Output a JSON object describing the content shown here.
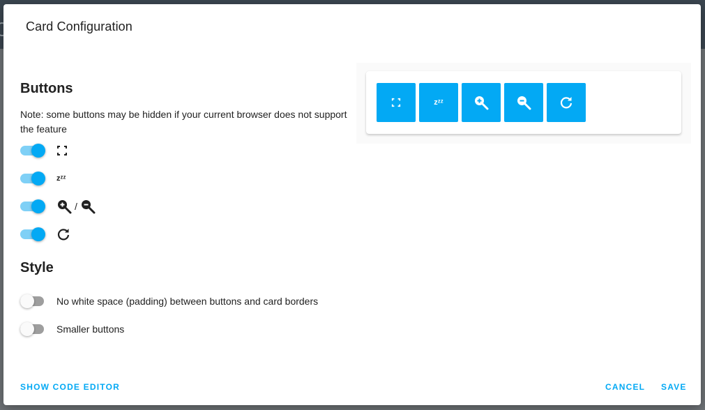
{
  "dialog": {
    "title": "Card Configuration"
  },
  "buttons_section": {
    "title": "Buttons",
    "note": "Note: some buttons may be hidden if your current browser does not support the feature",
    "rows": [
      {
        "icon": "fullscreen-icon",
        "enabled": true
      },
      {
        "icon": "sleep-zzz-icon",
        "enabled": true,
        "glyph": "zᶻᶻ"
      },
      {
        "icon": "zoom-in-out-icons",
        "enabled": true,
        "separator": "/"
      },
      {
        "icon": "refresh-icon",
        "enabled": true
      }
    ]
  },
  "style_section": {
    "title": "Style",
    "options": [
      {
        "label": "No white space (padding) between buttons and card borders",
        "enabled": false
      },
      {
        "label": "Smaller buttons",
        "enabled": false
      }
    ]
  },
  "preview": {
    "buttons": [
      "fullscreen-icon",
      "sleep-zzz-icon",
      "zoom-in-icon",
      "zoom-out-icon",
      "refresh-icon"
    ]
  },
  "footer": {
    "show_code_editor": "SHOW CODE EDITOR",
    "cancel": "CANCEL",
    "save": "SAVE"
  },
  "colors": {
    "accent": "#03a9f4",
    "toggle_track_on": "#7fd0f6",
    "toggle_track_off": "#9e9e9e"
  }
}
